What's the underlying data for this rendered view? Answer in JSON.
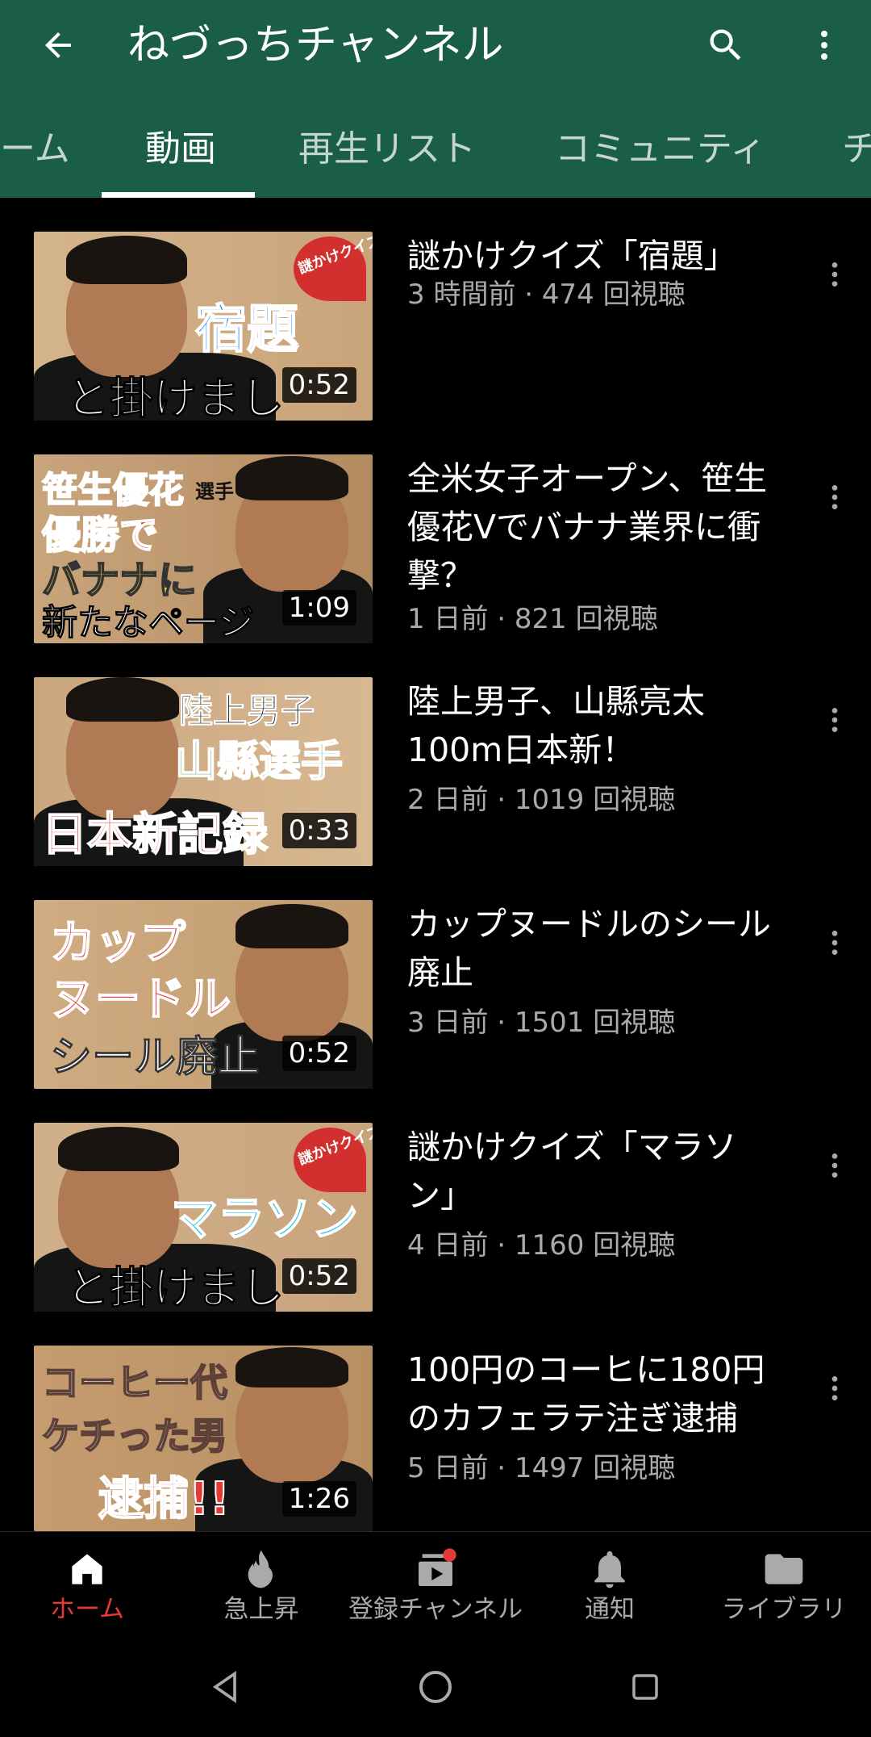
{
  "header": {
    "channel_title": "ねづっちチャンネル",
    "back_icon": "arrow-back-icon",
    "search_icon": "search-icon",
    "more_icon": "more-vert-icon",
    "background": "#195e45"
  },
  "tabs": [
    {
      "label": "ーム",
      "active": false
    },
    {
      "label": "動画",
      "active": true
    },
    {
      "label": "再生リスト",
      "active": false
    },
    {
      "label": "コミュニティ",
      "active": false
    },
    {
      "label": "チ",
      "active": false
    }
  ],
  "videos": [
    {
      "title": "謎かけクイズ「宿題」",
      "meta": "3 時間前 · 474 回視聴",
      "duration": "0:52",
      "thumb_text": [
        "宿題",
        "と掛けまし"
      ],
      "thumb_badge": "謎かけクイズ"
    },
    {
      "title": "全米女子オープン、笹生優花Vでバナナ業界に衝撃？",
      "meta": "1 日前 · 821 回視聴",
      "duration": "1:09",
      "thumb_text": [
        "笹生優花",
        "選手",
        "優勝で",
        "バナナに",
        "新たなページ"
      ]
    },
    {
      "title": "陸上男子、山縣亮太100m日本新！",
      "meta": "2 日前 · 1019 回視聴",
      "duration": "0:33",
      "thumb_text": [
        "陸上男子",
        "山縣選手",
        "日本新記録"
      ]
    },
    {
      "title": "カップヌードルのシール廃止",
      "meta": "3 日前 · 1501 回視聴",
      "duration": "0:52",
      "thumb_text": [
        "カップ",
        "ヌードル",
        "シール廃止"
      ]
    },
    {
      "title": "謎かけクイズ「マラソン」",
      "meta": "4 日前 · 1160 回視聴",
      "duration": "0:52",
      "thumb_text": [
        "マラソン",
        "と掛けまし"
      ],
      "thumb_badge": "謎かけクイズ"
    },
    {
      "title": "100円のコーヒに180円のカフェラテ注ぎ逮捕",
      "meta": "5 日前 · 1497 回視聴",
      "duration": "1:26",
      "thumb_text": [
        "コーヒー代",
        "ケチった男",
        "逮捕!!"
      ]
    }
  ],
  "bottom_nav": [
    {
      "label": "ホーム",
      "icon": "home-icon",
      "active": true
    },
    {
      "label": "急上昇",
      "icon": "trending-fire-icon",
      "active": false
    },
    {
      "label": "登録チャンネル",
      "icon": "subscriptions-icon",
      "active": false,
      "badge_dot": true
    },
    {
      "label": "通知",
      "icon": "bell-icon",
      "active": false
    },
    {
      "label": "ライブラリ",
      "icon": "folder-icon",
      "active": false
    }
  ],
  "colors": {
    "accent_red": "#e53935",
    "meta_gray": "#aaaaaa",
    "bg": "#000000"
  }
}
